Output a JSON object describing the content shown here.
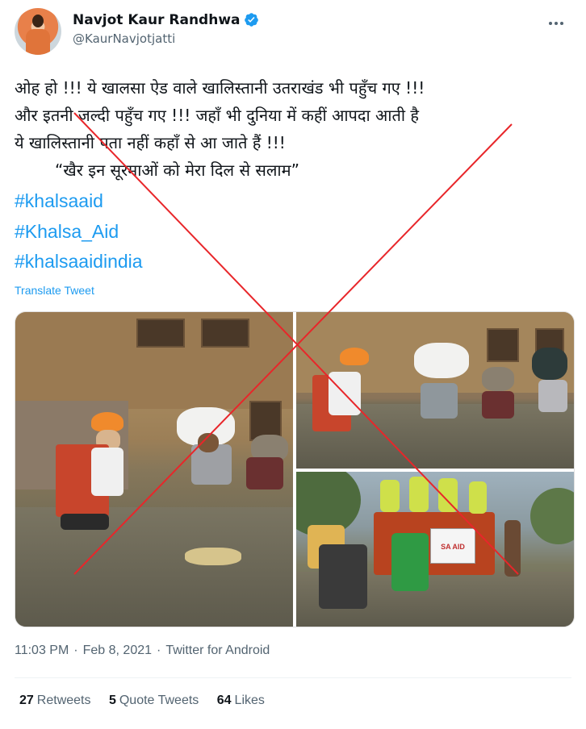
{
  "author": {
    "name": "Navjot Kaur Randhwa",
    "handle": "@KaurNavjotjatti"
  },
  "tweet": {
    "lines": [
      "ओह हो !!! ये खालसा ऐड वाले खालिस्तानी उतराखंड भी पहुँच गए !!!",
      "और इतनी जल्दी पहुँच गए !!! जहाँ भी दुनिया में कहीं आपदा आती है",
      "ये खालिस्तानी पता नहीं कहाँ से आ जाते हैं !!!",
      "“खैर इन सूरमाओं को मेरा दिल से सलाम”"
    ],
    "hashtags": [
      "#khalsaaid",
      "#Khalsa_Aid",
      "#khalsaaidindia"
    ],
    "translate_label": "Translate Tweet"
  },
  "media": {
    "banner_text": "SA AID"
  },
  "meta": {
    "time": "11:03 PM",
    "date": "Feb 8, 2021",
    "source": "Twitter for Android"
  },
  "stats": {
    "retweets_count": "27",
    "retweets_label": "Retweets",
    "quotes_count": "5",
    "quotes_label": "Quote Tweets",
    "likes_count": "64",
    "likes_label": "Likes"
  },
  "colors": {
    "link": "#1d9bf0",
    "verified": "#1d9bf0",
    "cross_mark": "#e8262a"
  }
}
